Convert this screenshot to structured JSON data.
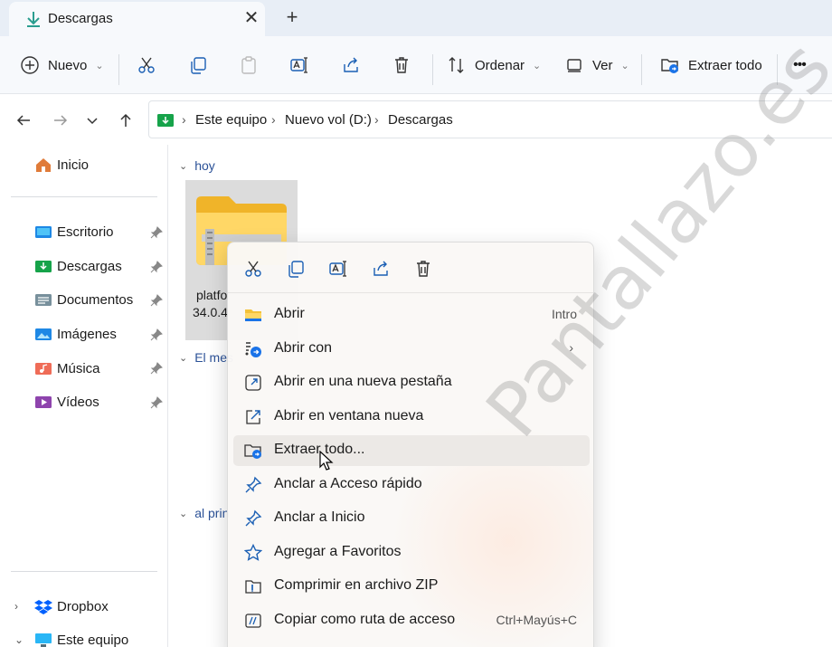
{
  "tab": {
    "title": "Descargas",
    "close": "✕",
    "new_tab": "+"
  },
  "toolbar": {
    "new_label": "Nuevo",
    "sort_label": "Ordenar",
    "view_label": "Ver",
    "extract_label": "Extraer todo",
    "more_label": "•••"
  },
  "address": {
    "crumbs": [
      "Este equipo",
      "Nuevo vol (D:)",
      "Descargas"
    ],
    "separator": "›"
  },
  "sidebar": {
    "items": [
      {
        "label": "Inicio",
        "icon": "home-icon"
      },
      {
        "label": "Escritorio",
        "icon": "desktop-folder-icon"
      },
      {
        "label": "Descargas",
        "icon": "downloads-folder-icon"
      },
      {
        "label": "Documentos",
        "icon": "documents-folder-icon"
      },
      {
        "label": "Imágenes",
        "icon": "pictures-folder-icon"
      },
      {
        "label": "Música",
        "icon": "music-folder-icon"
      },
      {
        "label": "Vídeos",
        "icon": "videos-folder-icon"
      },
      {
        "label": "Dropbox",
        "icon": "dropbox-icon"
      },
      {
        "label": "Este equipo",
        "icon": "pc-icon"
      }
    ]
  },
  "content": {
    "groups": [
      "hoy",
      "El mes",
      "al prin"
    ],
    "file": {
      "name_line1": "platfo",
      "name_line2": "34.0.4"
    }
  },
  "context_menu": {
    "items": [
      {
        "label": "Abrir",
        "shortcut": "Intro",
        "icon": "folder-icon"
      },
      {
        "label": "Abrir con",
        "arrow": "›",
        "icon": "open-with-icon"
      },
      {
        "label": "Abrir en una nueva pestaña",
        "icon": "new-tab-icon"
      },
      {
        "label": "Abrir en ventana nueva",
        "icon": "new-window-icon"
      },
      {
        "label": "Extraer todo...",
        "icon": "extract-icon"
      },
      {
        "label": "Anclar a Acceso rápido",
        "icon": "pin-icon"
      },
      {
        "label": "Anclar a Inicio",
        "icon": "pin-icon"
      },
      {
        "label": "Agregar a Favoritos",
        "icon": "star-icon"
      },
      {
        "label": "Comprimir en archivo ZIP",
        "icon": "zip-icon"
      },
      {
        "label": "Copiar como ruta de acceso",
        "shortcut": "Ctrl+Mayús+C",
        "icon": "copy-path-icon"
      }
    ]
  },
  "watermark": "Pantallazo.es",
  "colors": {
    "accent": "#0f6cbd",
    "folder_yellow": "#f3c23a",
    "hover": "#ece9e6"
  }
}
